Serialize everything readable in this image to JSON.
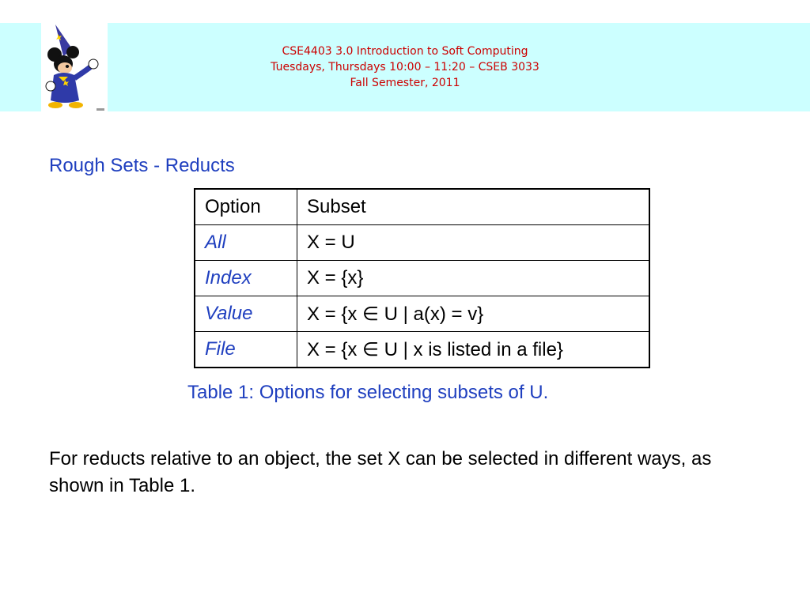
{
  "header": {
    "logo_icon": "wizard-mouse-mascot",
    "lines": [
      "CSE4403 3.0 Introduction to Soft Computing",
      "Tuesdays, Thursdays 10:00 – 11:20 – CSEB 3033",
      "Fall Semester, 2011"
    ]
  },
  "slide": {
    "title": "Rough Sets - Reducts",
    "table": {
      "columns": [
        "Option",
        "Subset"
      ],
      "rows": [
        {
          "option": "All",
          "subset": "X = U"
        },
        {
          "option": "Index",
          "subset": "X = {x}"
        },
        {
          "option": "Value",
          "subset": "X = {x ∈ U | a(x) = v}"
        },
        {
          "option": "File",
          "subset": "X = {x ∈ U | x is listed in a file}"
        }
      ]
    },
    "caption": "Table 1: Options for selecting subsets of U.",
    "body": "For reducts relative to an object, the set X can be selected in different ways, as shown in Table 1."
  },
  "colors": {
    "header_band": "#ccffff",
    "header_text": "#cc0000",
    "accent_blue": "#1f3fbf"
  }
}
